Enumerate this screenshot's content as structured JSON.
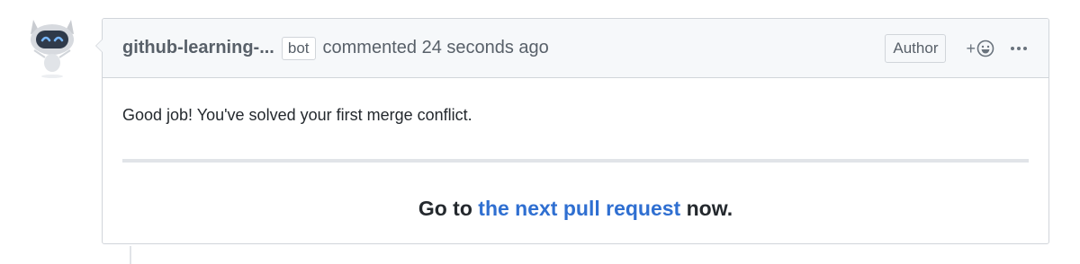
{
  "comment": {
    "author": "github-learning-...",
    "badge": "bot",
    "timestamp": "commented 24 seconds ago",
    "author_label": "Author",
    "reaction_plus": "+",
    "body": "Good job! You've solved your first merge conflict.",
    "cta_prefix": "Go to ",
    "cta_link": "the next pull request",
    "cta_suffix": " now."
  },
  "icons": {
    "avatar": "octobot-avatar",
    "reaction": "smiley-icon",
    "menu": "kebab-menu-icon"
  },
  "colors": {
    "link": "#2f6fd1",
    "header_bg": "#f6f8fa",
    "border": "#d1d5da",
    "muted_text": "#586069"
  }
}
